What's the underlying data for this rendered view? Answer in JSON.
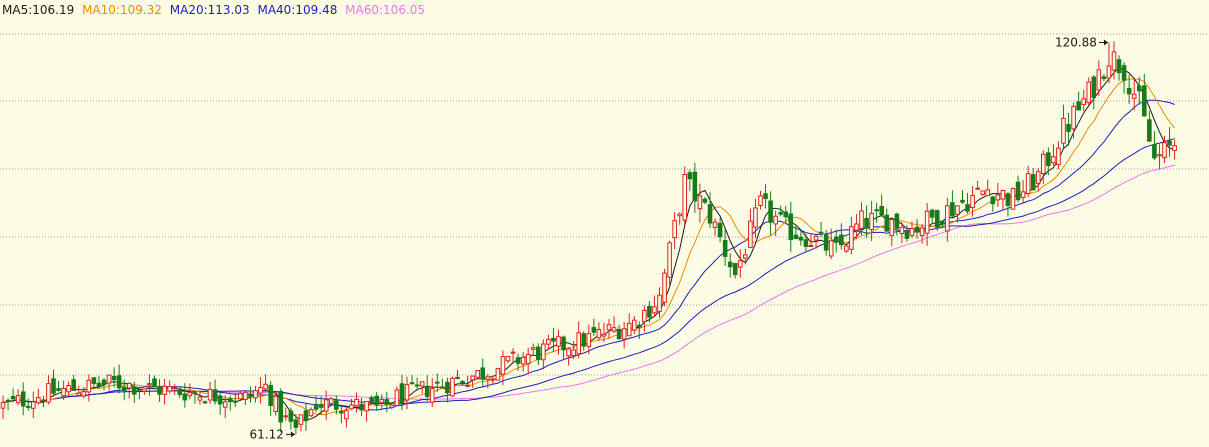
{
  "chart_data": {
    "type": "candlestick",
    "legend": [
      {
        "name": "MA5",
        "value": "106.19",
        "label": "MA5:106.19",
        "color": "#1a1a1a"
      },
      {
        "name": "MA10",
        "value": "109.32",
        "label": "MA10:109.32",
        "color": "#f08c00"
      },
      {
        "name": "MA20",
        "value": "113.03",
        "label": "MA20:113.03",
        "color": "#1d1dbd"
      },
      {
        "name": "MA40",
        "value": "109.48",
        "label": "MA40:109.48",
        "color": "#1d1dbd"
      },
      {
        "name": "MA60",
        "value": "106.05",
        "label": "MA60:106.05",
        "color": "#e97be9"
      }
    ],
    "annotations": [
      {
        "text": "120.88",
        "price": 120.88,
        "candle": 219,
        "marks": "high"
      },
      {
        "text": "61.12",
        "price": 61.12,
        "candle": 58,
        "marks": "low"
      }
    ],
    "ylim": [
      59.5,
      124.0
    ],
    "grid": true,
    "colors": {
      "up": "#e02020",
      "down": "#1a7a1a",
      "grid": "#a0a0a0",
      "background": "#fdfde6"
    },
    "candles_count": 233,
    "anchor_prices": [
      [
        0,
        65.5
      ],
      [
        10,
        67.6
      ],
      [
        22,
        69.0
      ],
      [
        30,
        68.1
      ],
      [
        40,
        67.2
      ],
      [
        48,
        66.7
      ],
      [
        52,
        68.4
      ],
      [
        55,
        64.0
      ],
      [
        58,
        61.9
      ],
      [
        62,
        65.8
      ],
      [
        68,
        65.7
      ],
      [
        75,
        65.0
      ],
      [
        78,
        66.8
      ],
      [
        85,
        68.3
      ],
      [
        95,
        70.5
      ],
      [
        105,
        73.5
      ],
      [
        115,
        75.5
      ],
      [
        125,
        78.2
      ],
      [
        130,
        82.0
      ],
      [
        135,
        99.6
      ],
      [
        140,
        94.5
      ],
      [
        145,
        85.5
      ],
      [
        150,
        96.0
      ],
      [
        155,
        92.5
      ],
      [
        160,
        91.0
      ],
      [
        165,
        89.0
      ],
      [
        170,
        93.5
      ],
      [
        175,
        94.0
      ],
      [
        180,
        92.5
      ],
      [
        185,
        94.5
      ],
      [
        190,
        96.5
      ],
      [
        195,
        98.5
      ],
      [
        200,
        97.0
      ],
      [
        205,
        100.5
      ],
      [
        210,
        107.5
      ],
      [
        215,
        113.0
      ],
      [
        219,
        119.0
      ],
      [
        222,
        117.0
      ],
      [
        225,
        111.5
      ],
      [
        228,
        103.0
      ],
      [
        230,
        104.0
      ],
      [
        232,
        105.5
      ]
    ],
    "moving_average_periods": {
      "MA5": 5,
      "MA10": 10,
      "MA20": 20,
      "MA40": 40,
      "MA60": 60
    }
  }
}
